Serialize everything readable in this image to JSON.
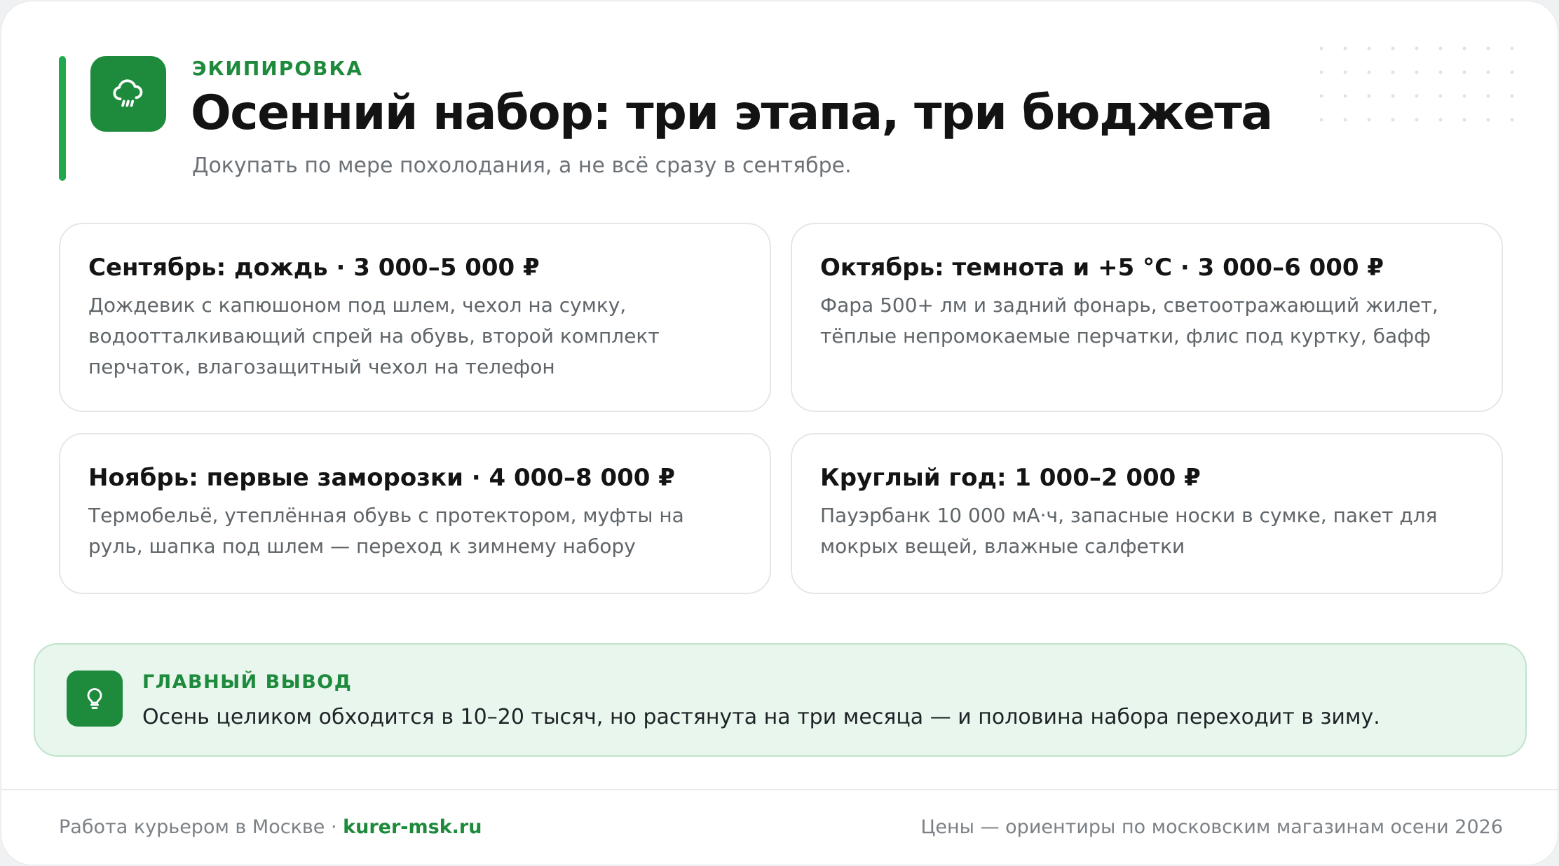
{
  "header": {
    "eyebrow": "ЭКИПИРОВКА",
    "title": "Осенний набор: три этапа, три бюджета",
    "subtitle": "Докупать по мере похолодания, а не всё сразу в сентябре.",
    "icon": "cloud-rain-icon"
  },
  "stages": [
    {
      "title": "Сентябрь: дождь · 3 000–5 000 ₽",
      "text": "Дождевик с капюшоном под шлем, чехол на сумку, водоотталкивающий спрей на обувь, второй комплект перчаток, влагозащитный чехол на телефон"
    },
    {
      "title": "Октябрь: темнота и +5 °C · 3 000–6 000 ₽",
      "text": "Фара 500+ лм и задний фонарь, светоотражающий жилет, тёплые непромокаемые перчатки, флис под куртку, бафф"
    },
    {
      "title": "Ноябрь: первые заморозки · 4 000–8 000 ₽",
      "text": "Термобельё, утеплённая обувь с протектором, муфты на руль, шапка под шлем — переход к зимнему набору"
    },
    {
      "title": "Круглый год: 1 000–2 000 ₽",
      "text": "Пауэрбанк 10 000 мА·ч, запасные носки в сумке, пакет для мокрых вещей, влажные салфетки"
    }
  ],
  "takeaway": {
    "label": "ГЛАВНЫЙ ВЫВОД",
    "text": "Осень целиком обходится в 10–20 тысяч, но растянута на три месяца — и половина набора переходит в зиму.",
    "icon": "lightbulb-icon"
  },
  "footer": {
    "site_name": "Работа курьером в Москве",
    "separator": " · ",
    "link": "kurer-msk.ru",
    "note": "Цены — ориентиры по московским магазинам осени 2026"
  },
  "colors": {
    "accent": "#1d8a3c",
    "accent_bar": "#21a84d",
    "takeaway_bg": "#e9f6ee",
    "takeaway_border": "#bfe3c9"
  }
}
